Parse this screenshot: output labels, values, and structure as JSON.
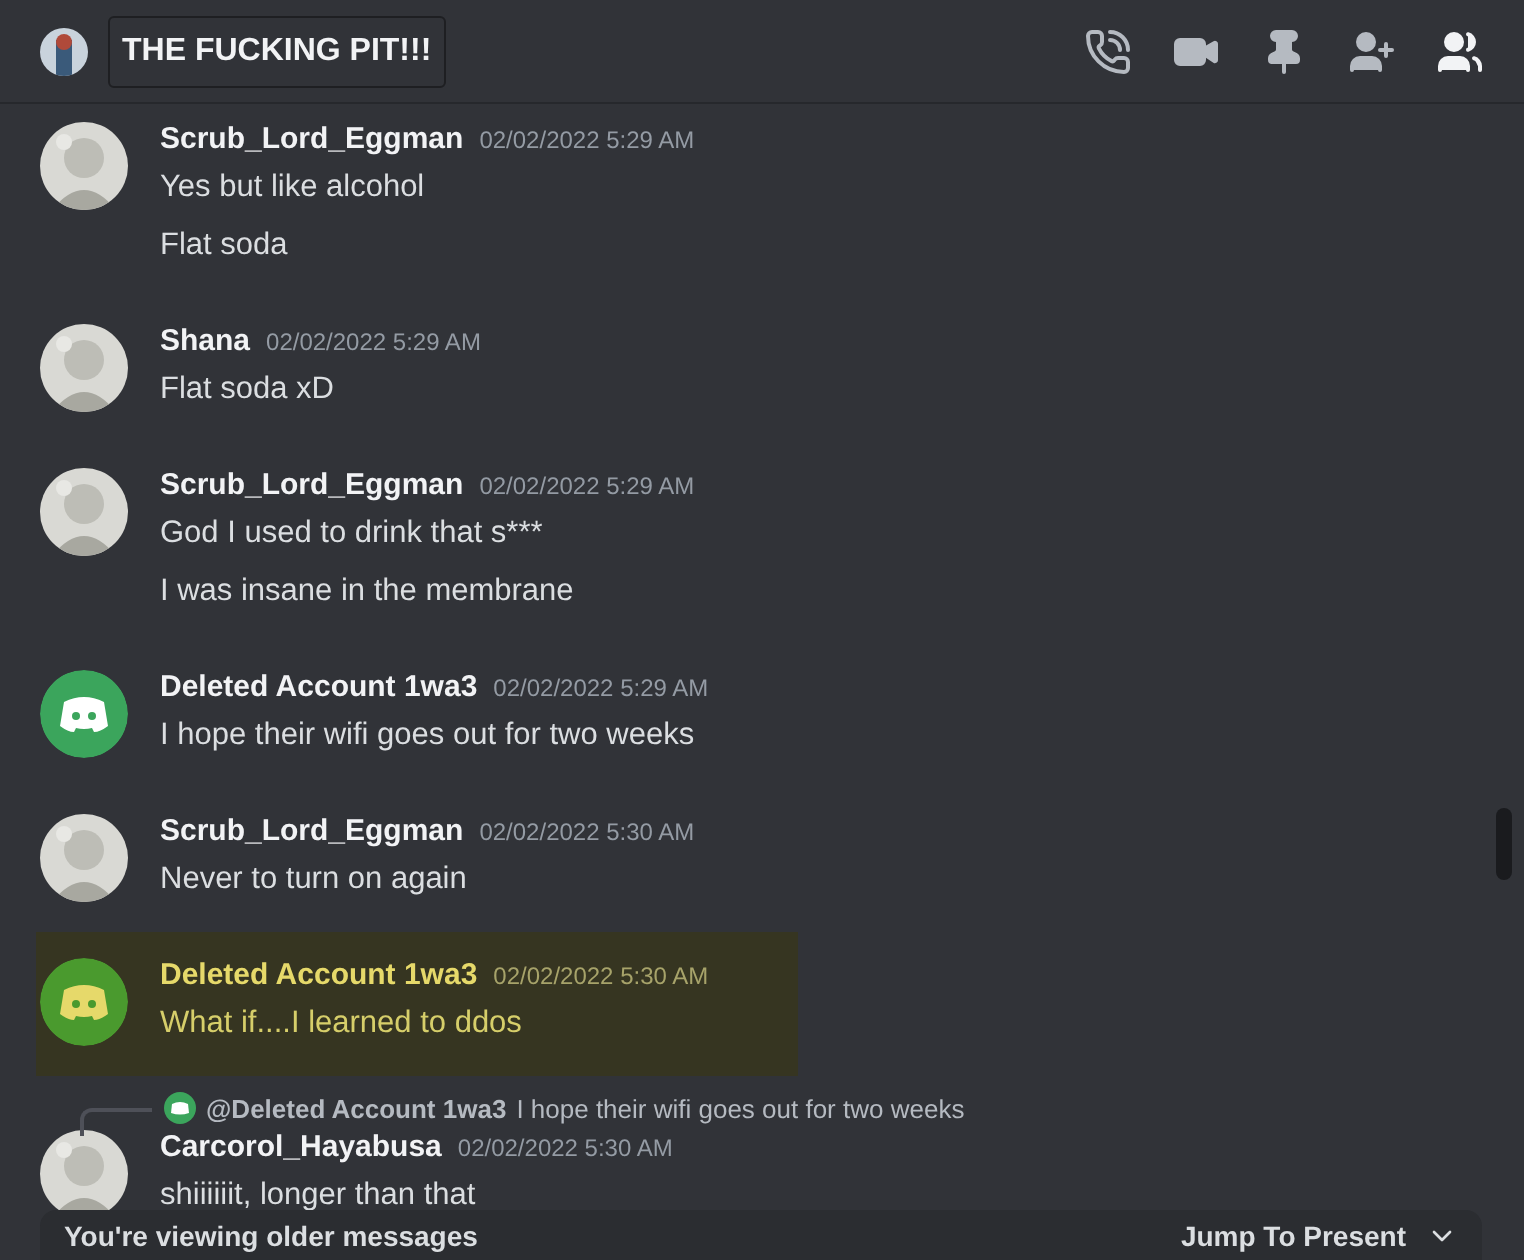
{
  "channel": {
    "title": "THE FUCKING PIT!!!"
  },
  "messages": [
    {
      "author": "Scrub_Lord_Eggman",
      "timestamp": "02/02/2022 5:29 AM",
      "avatar": {
        "kind": "picture"
      },
      "highlighted": false,
      "lines": [
        "Yes but like alcohol",
        "Flat soda"
      ]
    },
    {
      "author": "Shana",
      "timestamp": "02/02/2022 5:29 AM",
      "avatar": {
        "kind": "picture"
      },
      "highlighted": false,
      "lines": [
        "Flat soda xD"
      ]
    },
    {
      "author": "Scrub_Lord_Eggman",
      "timestamp": "02/02/2022 5:29 AM",
      "avatar": {
        "kind": "picture"
      },
      "highlighted": false,
      "lines": [
        "God I used to drink that s***",
        "I was insane in the membrane"
      ]
    },
    {
      "author": "Deleted Account 1wa3",
      "timestamp": "02/02/2022 5:29 AM",
      "avatar": {
        "kind": "discord"
      },
      "highlighted": false,
      "lines": [
        "I hope their wifi goes out for two weeks"
      ]
    },
    {
      "author": "Scrub_Lord_Eggman",
      "timestamp": "02/02/2022 5:30 AM",
      "avatar": {
        "kind": "picture"
      },
      "highlighted": false,
      "lines": [
        "Never to turn on again"
      ]
    },
    {
      "author": "Deleted Account 1wa3",
      "timestamp": "02/02/2022 5:30 AM",
      "avatar": {
        "kind": "discord"
      },
      "highlighted": true,
      "lines": [
        "What if....I learned to ddos"
      ]
    },
    {
      "author": "Carcorol_Hayabusa",
      "timestamp": "02/02/2022 5:30 AM",
      "avatar": {
        "kind": "picture"
      },
      "highlighted": false,
      "reply": {
        "author": "@Deleted Account 1wa3",
        "text": "I hope their wifi goes out for two weeks"
      },
      "lines": [
        "shiiiiiit, longer than that"
      ]
    }
  ],
  "notice": {
    "text": "You're viewing older messages",
    "action": "Jump To Present"
  }
}
